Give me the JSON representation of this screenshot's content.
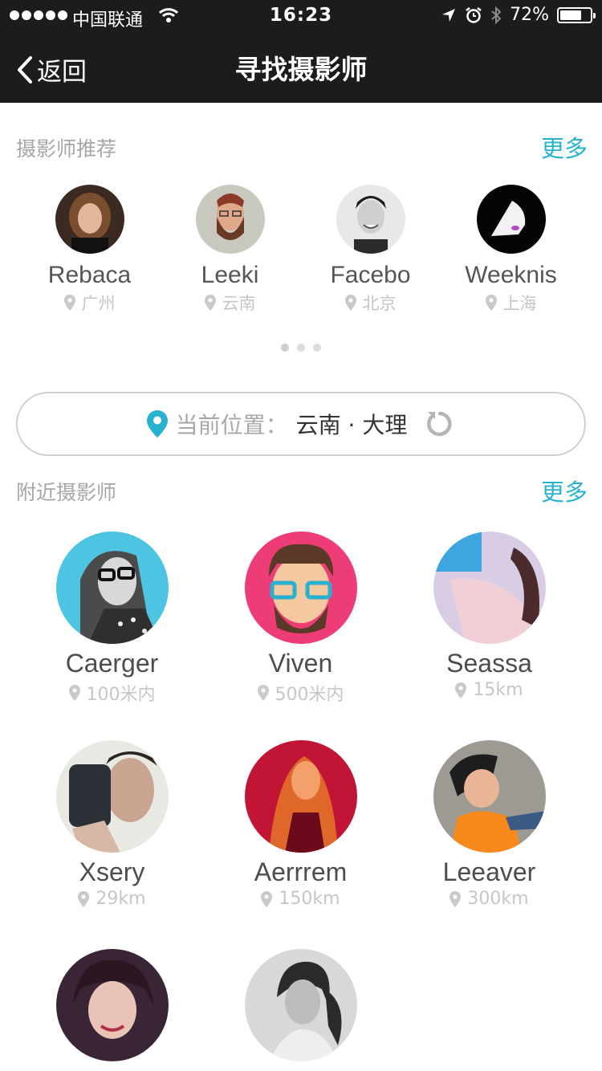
{
  "status_bar": {
    "carrier": "中国联通",
    "time": "16:23",
    "battery": "72%",
    "battery_level": 0.72
  },
  "nav": {
    "back_label": "返回",
    "title": "寻找摄影师"
  },
  "recommended": {
    "title": "摄影师推荐",
    "more": "更多",
    "items": [
      {
        "name": "Rebaca",
        "location": "广州"
      },
      {
        "name": "Leeki",
        "location": "云南"
      },
      {
        "name": "Facebo",
        "location": "北京"
      },
      {
        "name": "Weeknis",
        "location": "上海"
      }
    ],
    "pages": 3,
    "active_page": 1
  },
  "location_bar": {
    "label": "当前位置：",
    "city": "云南 · 大理"
  },
  "nearby": {
    "title": "附近摄影师",
    "more": "更多",
    "items": [
      {
        "name": "Caerger",
        "distance": "100米内"
      },
      {
        "name": "Viven",
        "distance": "500米内"
      },
      {
        "name": "Seassa",
        "distance": "15km"
      },
      {
        "name": "Xsery",
        "distance": "29km"
      },
      {
        "name": "Aerrrem",
        "distance": "150km"
      },
      {
        "name": "Leeaver",
        "distance": "300km"
      }
    ]
  },
  "colors": {
    "nav_bg": "#1c1c1e",
    "accent": "#27b3cf",
    "muted_text": "#a6a6a6"
  }
}
